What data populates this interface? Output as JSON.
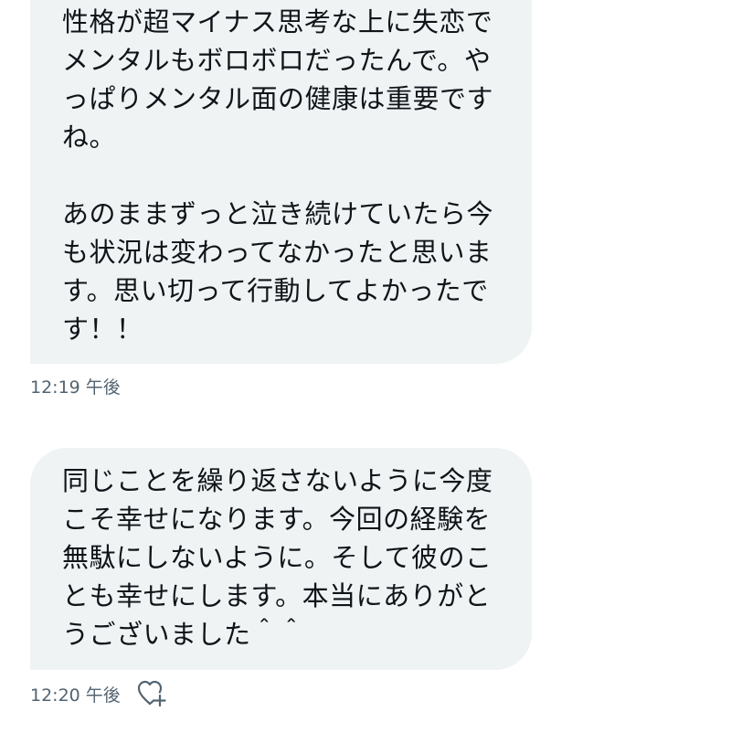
{
  "messages": [
    {
      "lines": [
        "性格が超マイナス思考な上に失恋で",
        "メンタルもボロボロだったんで。や",
        "っぱりメンタル面の健康は重要です",
        "ね。",
        "",
        "あのままずっと泣き続けていたら今",
        "も状況は変わってなかったと思いま",
        "す。思い切って行動してよかったで",
        "す！！"
      ],
      "timestamp": "12:19 午後"
    },
    {
      "lines": [
        "同じことを繰り返さないように今度",
        "こそ幸せになります。今回の経験を",
        "無駄にしないように。そして彼のこ",
        "とも幸せにします。本当にありがと",
        "うございました＾＾"
      ],
      "timestamp": "12:20 午後"
    }
  ]
}
